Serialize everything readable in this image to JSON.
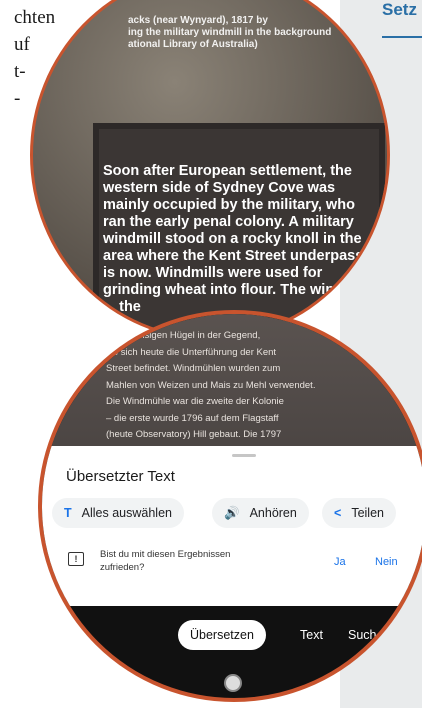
{
  "article_text": [
    "chten",
    "uf",
    "t-",
    "-"
  ],
  "sidebar": {
    "title": "Setz"
  },
  "photo": {
    "caption_lines": [
      "acks (near Wynyard), 1817 by",
      "ing the military windmill in the background",
      "ational Library of Australia)"
    ],
    "body": "Soon after European settlement, the western side of Sydney Cove was mainly occupied by the military, who ran the early penal colony. A military windmill stood on a rocky knoll in the area where the Kent Street underpass is now. Windmills were used for grinding wheat into flour. The windmill ... the"
  },
  "phone": {
    "overlay_text": [
      "einem felsigen Hügel in der Gegend,",
      "wo sich heute die Unterführung der Kent",
      "Street befindet. Windmühlen wurden zum",
      "Mahlen von Weizen und Mais zu Mehl verwendet.",
      "Die Windmühle war die zweite der Kolonie",
      "– die erste wurde 1796 auf dem Flagstaff",
      "(heute Observatory) Hill gebaut. Die 1797",
      "..."
    ],
    "sheet_title": "Übersetzter Text",
    "chips": {
      "select_all": {
        "icon": "T",
        "label": "Alles auswählen"
      },
      "listen": {
        "icon": "🔊",
        "label": "Anhören"
      },
      "share": {
        "icon": "<",
        "label": "Teilen"
      }
    },
    "feedback": {
      "icon": "!",
      "question": "Bist du mit diesen Ergebnissen zufrieden?",
      "yes": "Ja",
      "no": "Nein"
    },
    "modes": {
      "active": "Übersetzen",
      "text": "Text",
      "search": "Such"
    }
  }
}
